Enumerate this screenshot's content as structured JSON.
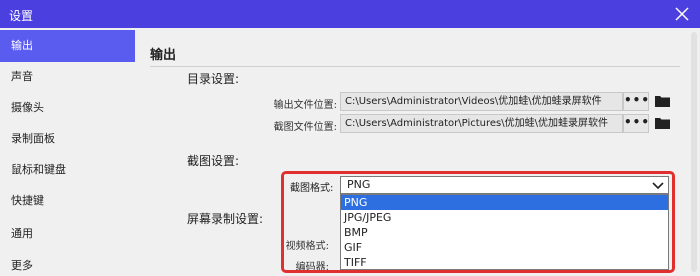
{
  "window": {
    "title": "设置"
  },
  "sidebar": {
    "items": [
      {
        "label": "输出",
        "active": true
      },
      {
        "label": "声音",
        "active": false
      },
      {
        "label": "摄像头",
        "active": false
      },
      {
        "label": "录制面板",
        "active": false
      },
      {
        "label": "鼠标和键盘",
        "active": false
      },
      {
        "label": "快捷键",
        "active": false
      },
      {
        "label": "通用",
        "active": false
      },
      {
        "label": "更多",
        "active": false
      }
    ]
  },
  "main": {
    "section_title": "输出",
    "directory": {
      "label": "目录设置:",
      "output_label": "输出文件位置:",
      "output_path": "C:\\Users\\Administrator\\Videos\\优加蛙\\优加蛙录屏软件",
      "screenshot_label": "截图文件位置:",
      "screenshot_path": "C:\\Users\\Administrator\\Pictures\\优加蛙\\优加蛙录屏软件",
      "browse_label": "•••"
    },
    "screenshot_settings": {
      "label": "截图设置:",
      "format_label": "截图格式:",
      "format_value": "PNG",
      "options": [
        "PNG",
        "JPG/JPEG",
        "BMP",
        "GIF",
        "TIFF"
      ],
      "selected_index": 0
    },
    "recording": {
      "label": "屏幕录制设置:",
      "video_format_label": "视频格式:",
      "encoder_label": "编码器:"
    }
  },
  "colors": {
    "titlebar": "#4b3fe0",
    "active_nav": "#5a5cf0",
    "highlight": "#e02f2f",
    "selected_option": "#2d6fe0"
  }
}
